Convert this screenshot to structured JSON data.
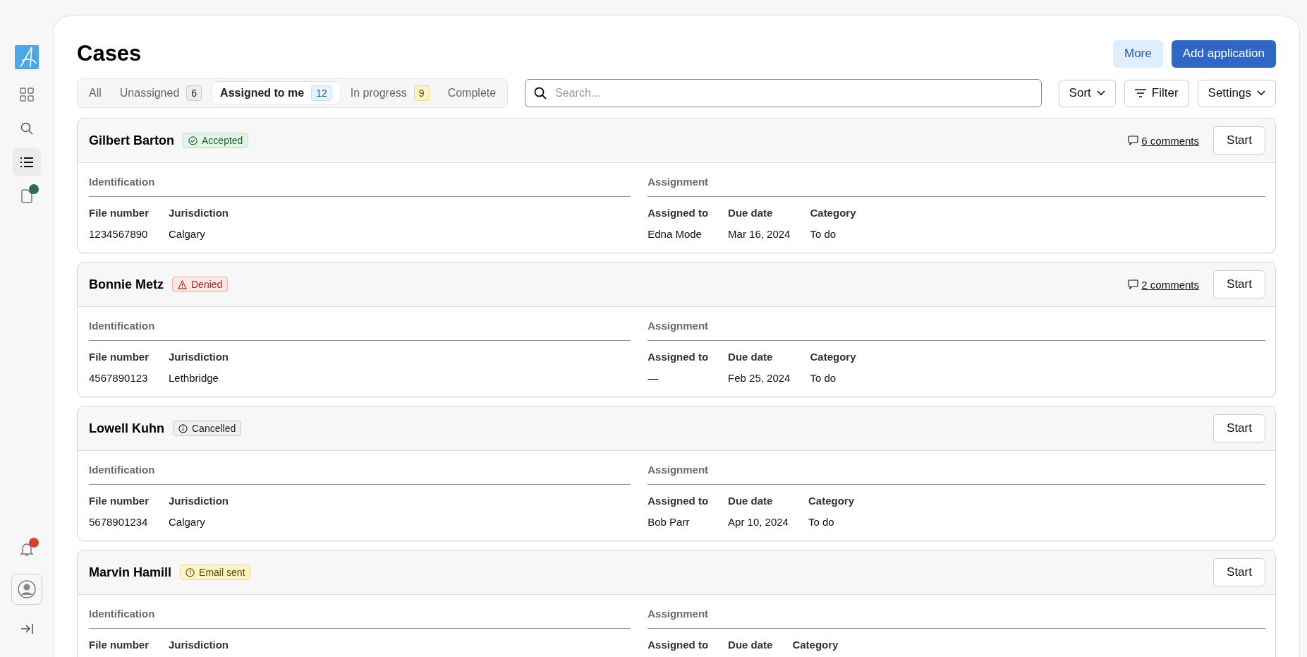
{
  "sidebar": {
    "items": [
      {
        "selected": false
      },
      {
        "selected": false
      },
      {
        "selected": true
      },
      {
        "selected": false,
        "color": "#2e6b4f"
      }
    ],
    "notifications": {
      "color": "#d2452b"
    }
  },
  "page": {
    "title": "Cases",
    "actions": [
      {
        "label": "More",
        "kind": "secondary"
      },
      {
        "label": "Add application",
        "kind": "primary"
      }
    ]
  },
  "tabs": [
    {
      "label": "All",
      "selected": false
    },
    {
      "label": "Unassigned",
      "count": "6",
      "kind": "neutral",
      "selected": false
    },
    {
      "label": "Assigned to me",
      "count": "12",
      "kind": "info",
      "selected": true
    },
    {
      "label": "In progress",
      "count": "9",
      "kind": "warning",
      "selected": false
    },
    {
      "label": "Complete",
      "selected": false
    }
  ],
  "search": {
    "placeholder": "Search..."
  },
  "toolbar": [
    {
      "label": "Sort",
      "kind": "dropdown"
    },
    {
      "label": "Filter",
      "kind": "filter"
    },
    {
      "label": "Settings",
      "kind": "dropdown"
    }
  ],
  "cases": [
    {
      "name": "Gilbert Barton",
      "status": {
        "label": "Accepted",
        "kind": "success"
      },
      "comments": "6 comments",
      "action": "Start",
      "sections": [
        {
          "title": "Identification",
          "fields": [
            {
              "label": "File number",
              "value": "1234567890"
            },
            {
              "label": "Jurisdiction",
              "value": "Calgary"
            }
          ]
        },
        {
          "title": "Assignment",
          "fields": [
            {
              "label": "Assigned to",
              "value": "Edna Mode"
            },
            {
              "label": "Due date",
              "value": "Mar 16, 2024"
            },
            {
              "label": "Category",
              "value": "To do"
            }
          ]
        }
      ]
    },
    {
      "name": "Bonnie Metz",
      "status": {
        "label": "Denied",
        "kind": "danger"
      },
      "comments": "2 comments",
      "action": "Start",
      "sections": [
        {
          "title": "Identification",
          "fields": [
            {
              "label": "File number",
              "value": "4567890123"
            },
            {
              "label": "Jurisdiction",
              "value": "Lethbridge"
            }
          ]
        },
        {
          "title": "Assignment",
          "fields": [
            {
              "label": "Assigned to",
              "value": "—"
            },
            {
              "label": "Due date",
              "value": "Feb 25, 2024"
            },
            {
              "label": "Category",
              "value": "To do"
            }
          ]
        }
      ]
    },
    {
      "name": "Lowell Kuhn",
      "status": {
        "label": "Cancelled",
        "kind": "neutral"
      },
      "action": "Start",
      "sections": [
        {
          "title": "Identification",
          "fields": [
            {
              "label": "File number",
              "value": "5678901234"
            },
            {
              "label": "Jurisdiction",
              "value": "Calgary"
            }
          ]
        },
        {
          "title": "Assignment",
          "fields": [
            {
              "label": "Assigned to",
              "value": "Bob Parr"
            },
            {
              "label": "Due date",
              "value": "Apr 10, 2024"
            },
            {
              "label": "Category",
              "value": "To do"
            }
          ]
        }
      ]
    },
    {
      "name": "Marvin Hamill",
      "status": {
        "label": "Email sent",
        "kind": "warning"
      },
      "action": "Start",
      "sections": [
        {
          "title": "Identification",
          "fields": [
            {
              "label": "File number"
            },
            {
              "label": "Jurisdiction"
            }
          ]
        },
        {
          "title": "Assignment",
          "fields": [
            {
              "label": "Assigned to"
            },
            {
              "label": "Due date"
            },
            {
              "label": "Category"
            }
          ]
        }
      ]
    }
  ]
}
